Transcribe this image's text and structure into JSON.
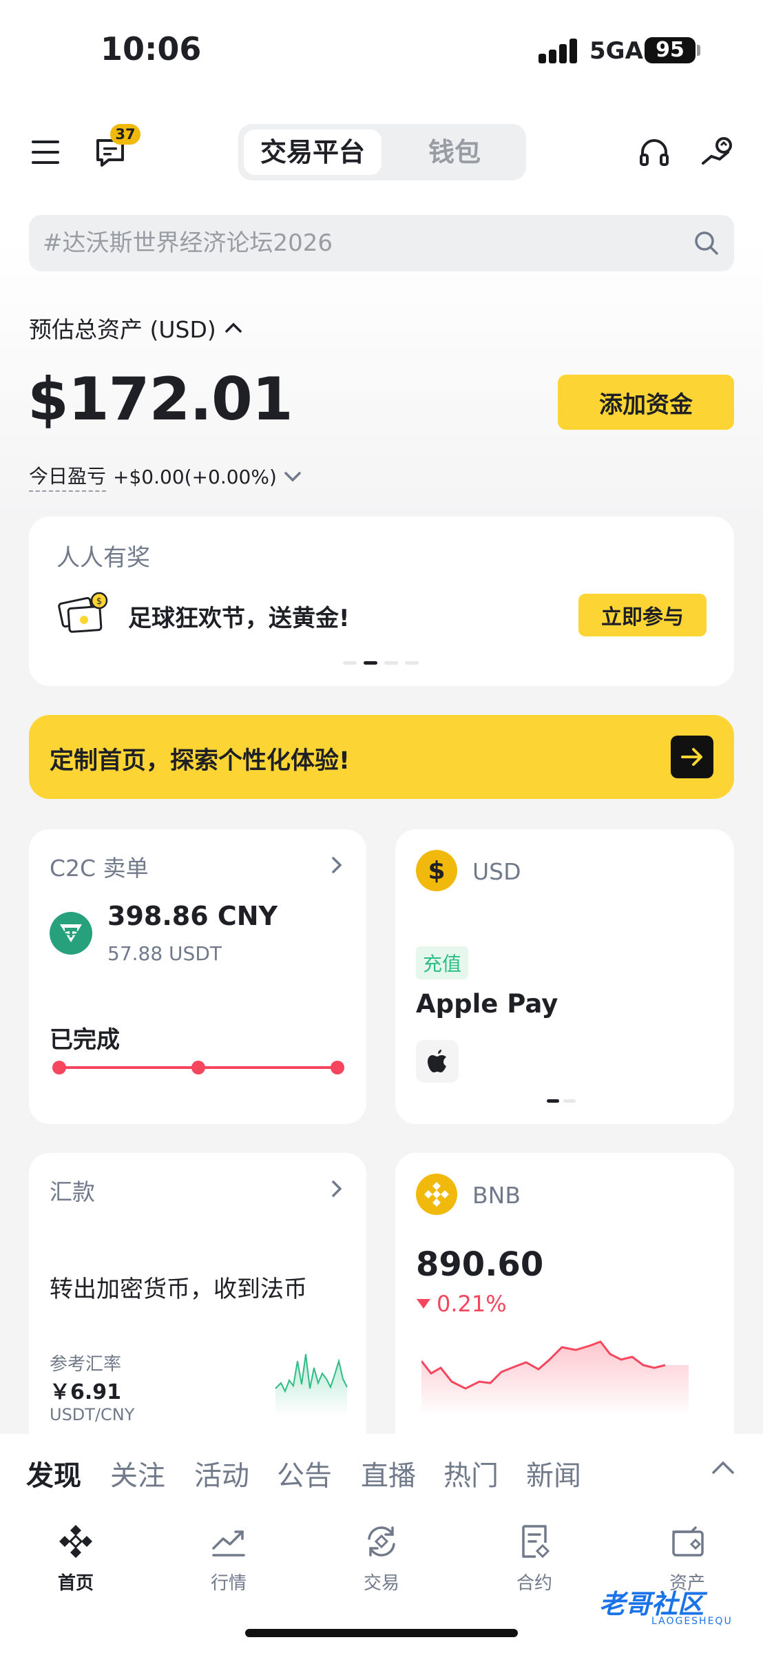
{
  "status_bar": {
    "time": "10:06",
    "network": "5GA",
    "battery": "95"
  },
  "header": {
    "notification_count": "37",
    "tabs": [
      {
        "label": "交易平台",
        "active": true
      },
      {
        "label": "钱包",
        "active": false
      }
    ]
  },
  "search": {
    "placeholder": "#达沃斯世界经济论坛2026"
  },
  "assets": {
    "label": "预估总资产 (USD)",
    "value": "$172.01",
    "add_funds": "添加资金",
    "pnl_label": "今日盈亏",
    "pnl_value": "+$0.00(+0.00%)"
  },
  "reward": {
    "title": "人人有奖",
    "text": "足球狂欢节，送黄金!",
    "button": "立即参与"
  },
  "banner": {
    "text": "定制首页，探索个性化体验!"
  },
  "c2c": {
    "title": "C2C 卖单",
    "amount": "398.86 CNY",
    "sub": "57.88 USDT",
    "status": "已完成"
  },
  "usd_card": {
    "coin": "USD",
    "coin_symbol": "$",
    "tag": "充值",
    "method": "Apple Pay"
  },
  "remit": {
    "title": "汇款",
    "desc": "转出加密货币，收到法币",
    "rate_label": "参考汇率",
    "rate_value": "￥6.91",
    "pair": "USDT/CNY"
  },
  "bnb": {
    "coin": "BNB",
    "price": "890.60",
    "change": "0.21%"
  },
  "feed_tabs": [
    "发现",
    "关注",
    "活动",
    "公告",
    "直播",
    "热门",
    "新闻"
  ],
  "nav": [
    {
      "label": "首页",
      "icon": "binance-home-icon"
    },
    {
      "label": "行情",
      "icon": "markets-icon"
    },
    {
      "label": "交易",
      "icon": "trade-icon"
    },
    {
      "label": "合约",
      "icon": "futures-icon"
    },
    {
      "label": "资产",
      "icon": "wallet-icon"
    }
  ],
  "watermark": {
    "text": "老哥社区",
    "sub": "LAOGESHEQU"
  },
  "colors": {
    "accent": "#fcd535",
    "down": "#f6465d",
    "up": "#2ebd85"
  }
}
